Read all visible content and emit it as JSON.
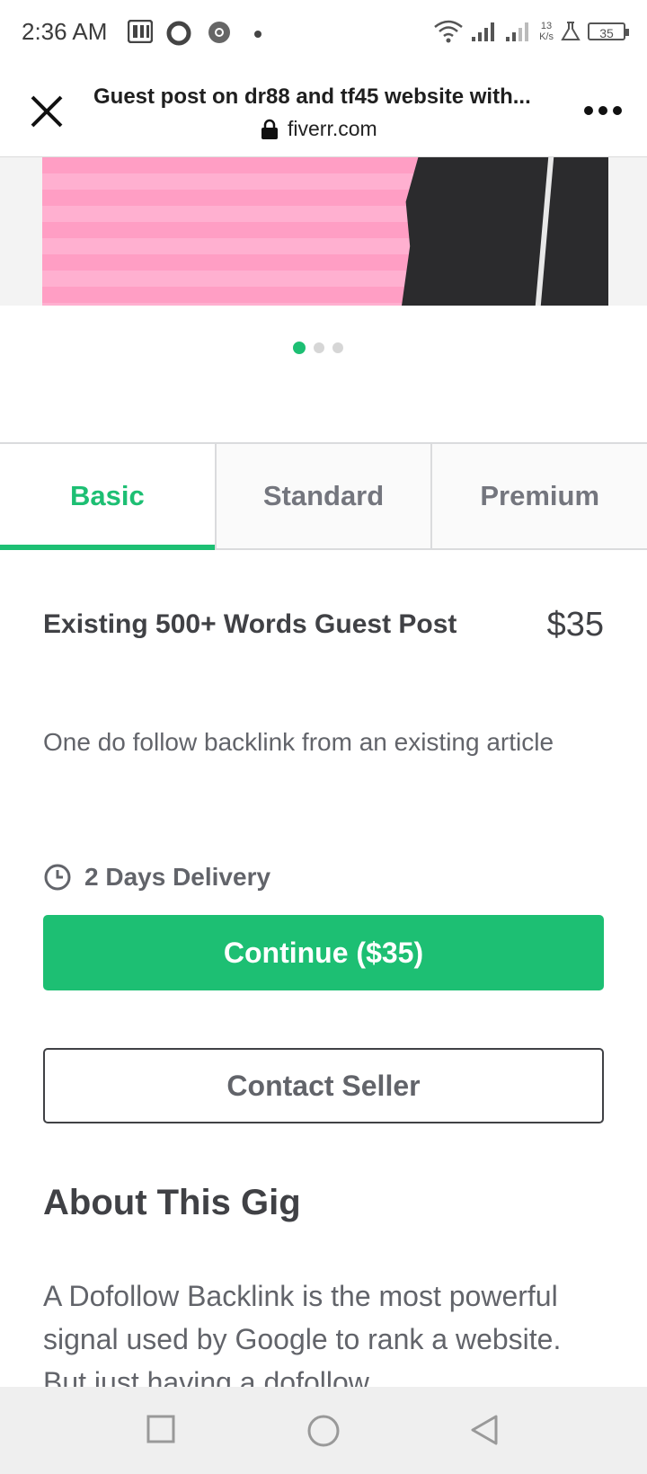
{
  "status_bar": {
    "time": "2:36 AM",
    "speed_value": "13",
    "speed_unit": "K/s",
    "battery": "35",
    "icons": [
      "pi-icon",
      "sync-icon",
      "chrome-icon",
      "dot-icon",
      "wifi-icon",
      "signal-icon",
      "signal-icon-2",
      "flask-icon",
      "battery-icon"
    ]
  },
  "browser": {
    "title": "Guest post on dr88 and tf45 website with...",
    "url": "fiverr.com"
  },
  "gallery": {
    "total": 3,
    "active_index": 0
  },
  "tabs": [
    "Basic",
    "Standard",
    "Premium"
  ],
  "active_tab": "Basic",
  "package": {
    "title": "Existing 500+ Words Guest Post",
    "price": "$35",
    "description": "One do follow backlink from an existing article",
    "delivery": "2 Days Delivery"
  },
  "actions": {
    "continue_label": "Continue ($35)",
    "contact_label": "Contact Seller"
  },
  "about": {
    "title": "About This Gig",
    "text": "A Dofollow Backlink is the most powerful signal used by Google to rank a website. But just having a dofollow"
  },
  "colors": {
    "accent": "#1dbf73",
    "text": "#404145",
    "muted": "#62646a"
  }
}
